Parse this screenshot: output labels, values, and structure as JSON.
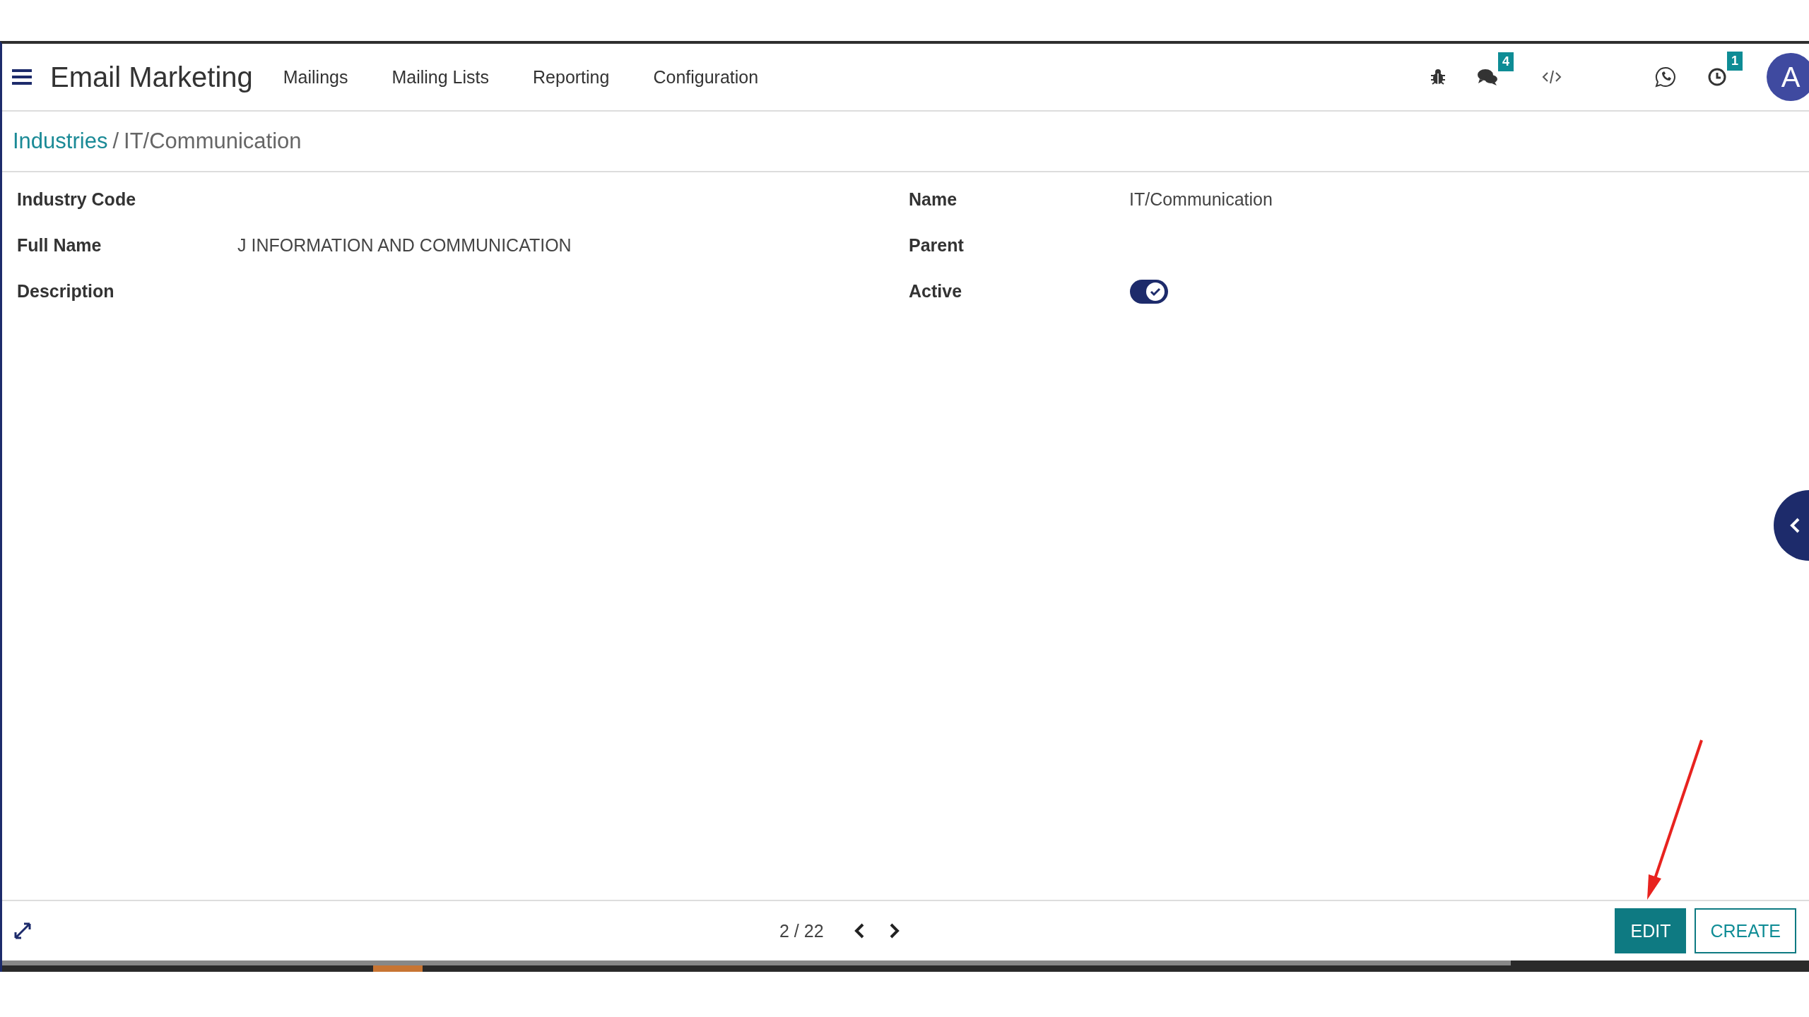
{
  "app_title": "Email Marketing",
  "menu": [
    "Mailings",
    "Mailing Lists",
    "Reporting",
    "Configuration"
  ],
  "systray": {
    "chat_badge": "4",
    "activity_badge": "1",
    "avatar": "A"
  },
  "breadcrumb": {
    "parent": "Industries",
    "separator": "/",
    "current": "IT/Communication"
  },
  "fields_left": [
    {
      "label": "Industry Code"
    },
    {
      "label": "Full Name",
      "value": "J INFORMATION AND COMMUNICATION"
    },
    {
      "label": "Description"
    }
  ],
  "fields_right": [
    {
      "label": "Name",
      "kind": "text",
      "value": "IT/Communication"
    },
    {
      "label": "Parent",
      "kind": "text"
    },
    {
      "label": "Active",
      "kind": "toggle",
      "on": true
    }
  ],
  "pager": "2 / 22",
  "buttons": [
    {
      "label": "EDIT",
      "primary": true
    },
    {
      "label": "CREATE",
      "primary": false
    }
  ]
}
